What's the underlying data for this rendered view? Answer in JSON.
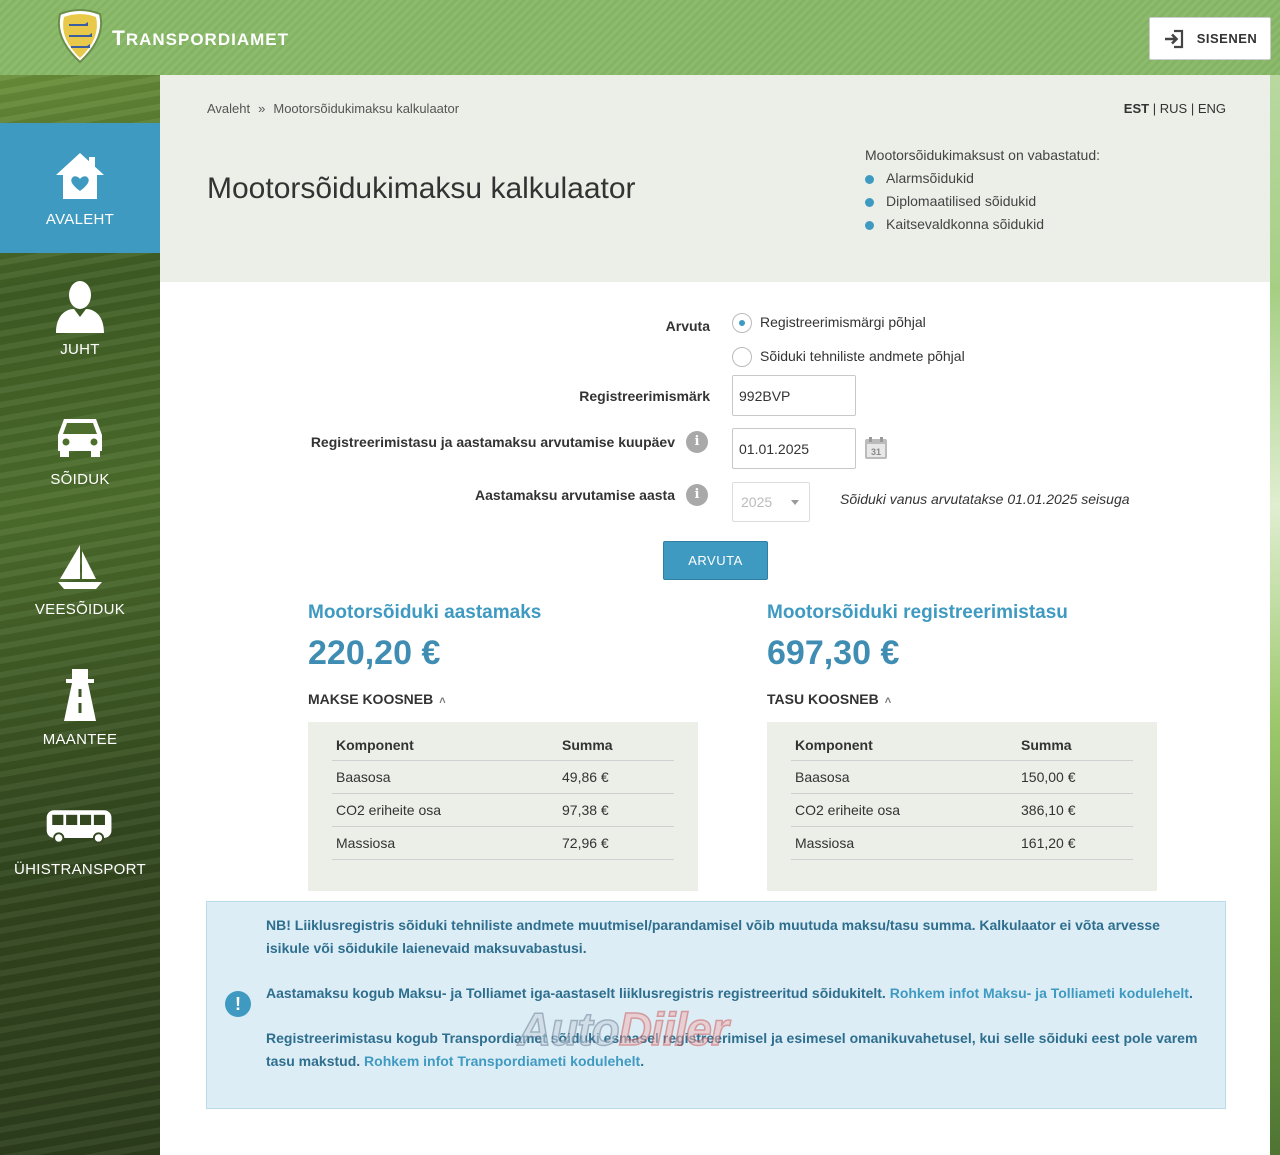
{
  "header": {
    "brand_first": "T",
    "brand_rest": "RANSPORDIAMET",
    "login_label": "SISENEN"
  },
  "sidebar": {
    "items": [
      {
        "label": "AVALEHT",
        "icon": "home-icon"
      },
      {
        "label": "JUHT",
        "icon": "person-icon"
      },
      {
        "label": "SÕIDUK",
        "icon": "car-icon"
      },
      {
        "label": "VEESÕIDUK",
        "icon": "sailboat-icon"
      },
      {
        "label": "MAANTEE",
        "icon": "road-icon"
      },
      {
        "label": "ÜHISTRANSPORT",
        "icon": "bus-icon"
      }
    ]
  },
  "breadcrumb": {
    "home": "Avaleht",
    "sep": "»",
    "current": "Mootorsõidukimaksu kalkulaator"
  },
  "languages": {
    "est": "EST",
    "rus": "RUS",
    "eng": "ENG",
    "divider": "|"
  },
  "page_title": "Mootorsõidukimaksu kalkulaator",
  "exempt": {
    "heading": "Mootorsõidukimaksust on vabastatud:",
    "items": [
      "Alarmsõidukid",
      "Diplomaatilised sõidukid",
      "Kaitsevaldkonna sõidukid"
    ]
  },
  "form": {
    "calc_label": "Arvuta",
    "radio_plate": "Registreerimismärgi põhjal",
    "radio_tech": "Sõiduki tehniliste andmete põhjal",
    "plate_label": "Registreerimismärk",
    "plate_value": "992BVP",
    "date_label": "Registreerimistasu ja aastamaksu arvutamise kuupäev",
    "date_value": "01.01.2025",
    "calendar_day": "31",
    "year_label": "Aastamaksu arvutamise aasta",
    "year_value": "2025",
    "year_note": "Sõiduki vanus arvutatakse 01.01.2025 seisuga",
    "info_glyph": "i",
    "submit_label": "ARVUTA"
  },
  "annual_tax": {
    "title": "Mootorsõiduki aastamaks",
    "amount": "220,20 €",
    "toggle": "MAKSE KOOSNEB",
    "col_component": "Komponent",
    "col_sum": "Summa",
    "rows": [
      {
        "component": "Baasosa",
        "sum": "49,86 €"
      },
      {
        "component": "CO2 eriheite osa",
        "sum": "97,38 €"
      },
      {
        "component": "Massiosa",
        "sum": "72,96 €"
      }
    ]
  },
  "registration_fee": {
    "title": "Mootorsõiduki registreerimistasu",
    "amount": "697,30 €",
    "toggle": "TASU KOOSNEB",
    "col_component": "Komponent",
    "col_sum": "Summa",
    "rows": [
      {
        "component": "Baasosa",
        "sum": "150,00 €"
      },
      {
        "component": "CO2 eriheite osa",
        "sum": "386,10 €"
      },
      {
        "component": "Massiosa",
        "sum": "161,20 €"
      }
    ]
  },
  "notice": {
    "bang": "!",
    "p1": "NB! Liiklusregistris sõiduki tehniliste andmete muutmisel/parandamisel võib muutuda maksu/tasu summa. Kalkulaator ei võta arvesse isikule või sõidukile laienevaid maksuvabastusi.",
    "p2_text": "Aastamaksu kogub Maksu- ja Tolliamet iga-aastaselt liiklusregistris registreeritud sõidukitelt. ",
    "p2_link": "Rohkem infot Maksu- ja Tolliameti kodulehelt",
    "p2_end": ".",
    "p3_text": "Registreerimistasu kogub Transpordiamet sõiduki esmasel registreerimisel ja esimesel omanikuvahetusel, kui selle sõiduki eest pole varem tasu makstud. ",
    "p3_link": "Rohkem infot Transpordiameti kodulehelt",
    "p3_end": "."
  },
  "watermark": {
    "part1": "Auto",
    "part2": "Diiler"
  },
  "colors": {
    "accent": "#3f9ac2",
    "header_green": "#8dbb6d",
    "panel_gray": "#eceee8",
    "notice_bg": "#dcedf5"
  }
}
